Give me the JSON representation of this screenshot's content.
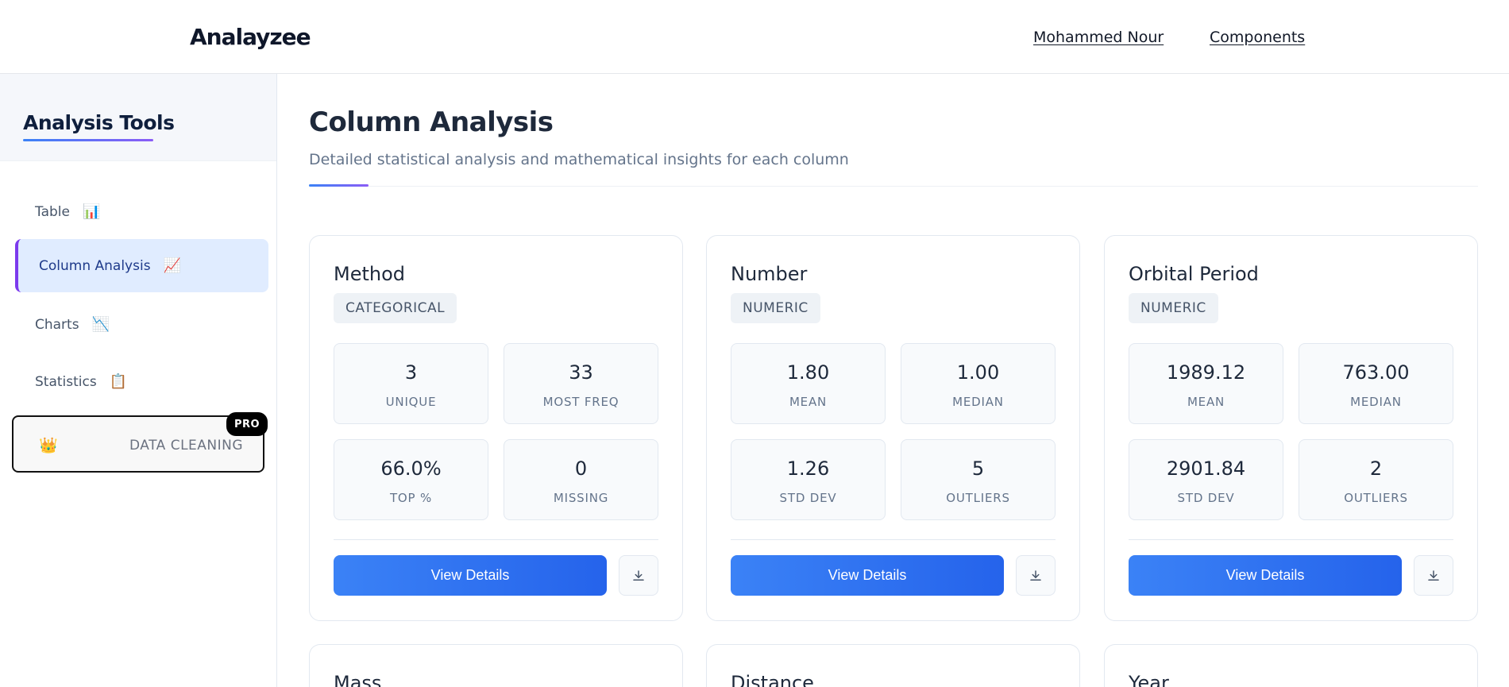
{
  "header": {
    "brand": "Analayzee",
    "links": [
      "Mohammed Nour",
      "Components"
    ]
  },
  "sidebar": {
    "title": "Analysis Tools",
    "items": [
      {
        "label": "Table",
        "emoji": "📊",
        "icon": "bar-chart-icon"
      },
      {
        "label": "Column Analysis",
        "emoji": "📈",
        "icon": "chart-increasing-icon",
        "active": true
      },
      {
        "label": "Charts",
        "emoji": "📉",
        "icon": "chart-decreasing-icon"
      },
      {
        "label": "Statistics",
        "emoji": "📋",
        "icon": "clipboard-icon"
      }
    ],
    "pro": {
      "label": "DATA CLEANING",
      "badge": "PRO",
      "emoji": "👑",
      "icon": "crown-icon"
    }
  },
  "main": {
    "title": "Column Analysis",
    "subtitle": "Detailed statistical analysis and mathematical insights for each column",
    "accent_color": "#3b82f6",
    "view_details_label": "View Details",
    "cards": [
      {
        "name": "Method",
        "type": "CATEGORICAL",
        "stats": [
          {
            "value": "3",
            "label": "UNIQUE"
          },
          {
            "value": "33",
            "label": "MOST FREQ"
          },
          {
            "value": "66.0%",
            "label": "TOP %"
          },
          {
            "value": "0",
            "label": "MISSING"
          }
        ]
      },
      {
        "name": "Number",
        "type": "NUMERIC",
        "stats": [
          {
            "value": "1.80",
            "label": "MEAN"
          },
          {
            "value": "1.00",
            "label": "MEDIAN"
          },
          {
            "value": "1.26",
            "label": "STD DEV"
          },
          {
            "value": "5",
            "label": "OUTLIERS"
          }
        ]
      },
      {
        "name": "Orbital Period",
        "type": "NUMERIC",
        "stats": [
          {
            "value": "1989.12",
            "label": "MEAN"
          },
          {
            "value": "763.00",
            "label": "MEDIAN"
          },
          {
            "value": "2901.84",
            "label": "STD DEV"
          },
          {
            "value": "2",
            "label": "OUTLIERS"
          }
        ]
      }
    ],
    "next_cards": [
      "Mass",
      "Distance",
      "Year"
    ]
  }
}
